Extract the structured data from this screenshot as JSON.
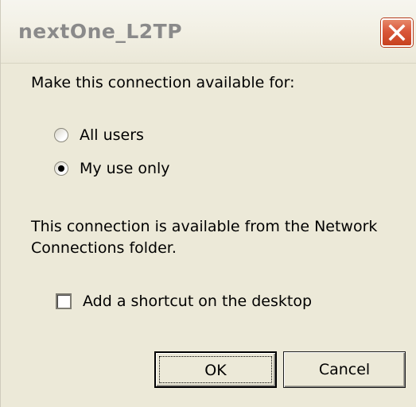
{
  "window": {
    "title": "nextOne_L2TP"
  },
  "availability": {
    "prompt": "Make this connection available for:",
    "options": [
      {
        "label": "All users",
        "selected": false
      },
      {
        "label": "My use only",
        "selected": true
      }
    ]
  },
  "info": {
    "line1": "This connection is available from the Network",
    "line2": "Connections folder."
  },
  "shortcut": {
    "label": "Add a shortcut on the desktop",
    "checked": false
  },
  "buttons": {
    "ok": "OK",
    "cancel": "Cancel"
  },
  "icons": {
    "close": "close-icon"
  },
  "colors": {
    "dialog_bg": "#ece9d8",
    "close_button": "#d9573a"
  }
}
